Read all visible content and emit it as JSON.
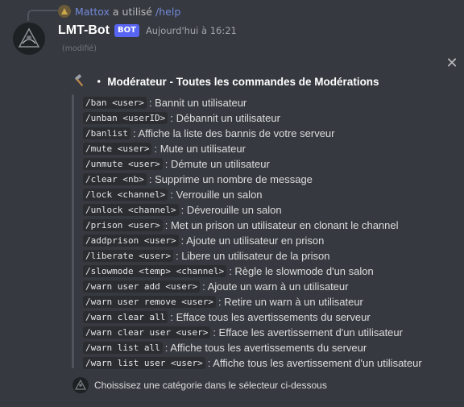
{
  "reply": {
    "user": "Mattox",
    "text": "a utilisé",
    "command": "/help"
  },
  "message": {
    "author": "LMT-Bot",
    "tag": "BOT",
    "timestamp": "Aujourd'hui à 16:21",
    "edited": "(modifié)"
  },
  "embed": {
    "title": "・ Modérateur - Toutes les commandes de Modérations",
    "commands": [
      {
        "code": "/ban <user>",
        "desc": ": Bannit un utilisateur"
      },
      {
        "code": "/unban <userID>",
        "desc": ": Débannit un utilisateur"
      },
      {
        "code": "/banlist",
        "desc": ": Affiche la liste des bannis de votre serveur"
      },
      {
        "code": "/mute <user>",
        "desc": ": Mute un utilisateur"
      },
      {
        "code": "/unmute <user>",
        "desc": ": Démute un utilisateur"
      },
      {
        "code": "/clear <nb>",
        "desc": ": Supprime un nombre de message"
      },
      {
        "code": "/lock <channel>",
        "desc": ": Verrouille un salon"
      },
      {
        "code": "/unlock <channel>",
        "desc": ": Déverouille un salon"
      },
      {
        "code": "/prison <user>",
        "desc": ": Met un prison un utilisateur en clonant le channel"
      },
      {
        "code": "/addprison <user>",
        "desc": ": Ajoute un utilisateur en prison"
      },
      {
        "code": "/liberate <user>",
        "desc": ": Libere un utilisateur de la prison"
      },
      {
        "code": "/slowmode <temp> <channel>",
        "desc": ": Règle le slowmode d'un salon"
      },
      {
        "code": "/warn user add <user>",
        "desc": ": Ajoute un warn à un utilisateur"
      },
      {
        "code": "/warn user remove <user>",
        "desc": ": Retire un warn à un utilisateur"
      },
      {
        "code": "/warn clear all",
        "desc": ": Efface tous les avertissements du serveur"
      },
      {
        "code": "/warn clear user <user>",
        "desc": ": Efface les avertissement d'un utilisateur"
      },
      {
        "code": "/warn list all",
        "desc": ": Affiche tous les avertissements du serveur"
      },
      {
        "code": "/warn list user <user>",
        "desc": ": Affiche tous les avertissement d'un utilisateur"
      }
    ],
    "footer": "Choissisez une catégorie dans le sélecteur ci-dessous"
  },
  "icons": {
    "hammer": "hammer-icon",
    "close": "close-icon"
  },
  "colors": {
    "background": "#36393f",
    "mention": "#7289da",
    "bot_tag": "#5865f2"
  }
}
